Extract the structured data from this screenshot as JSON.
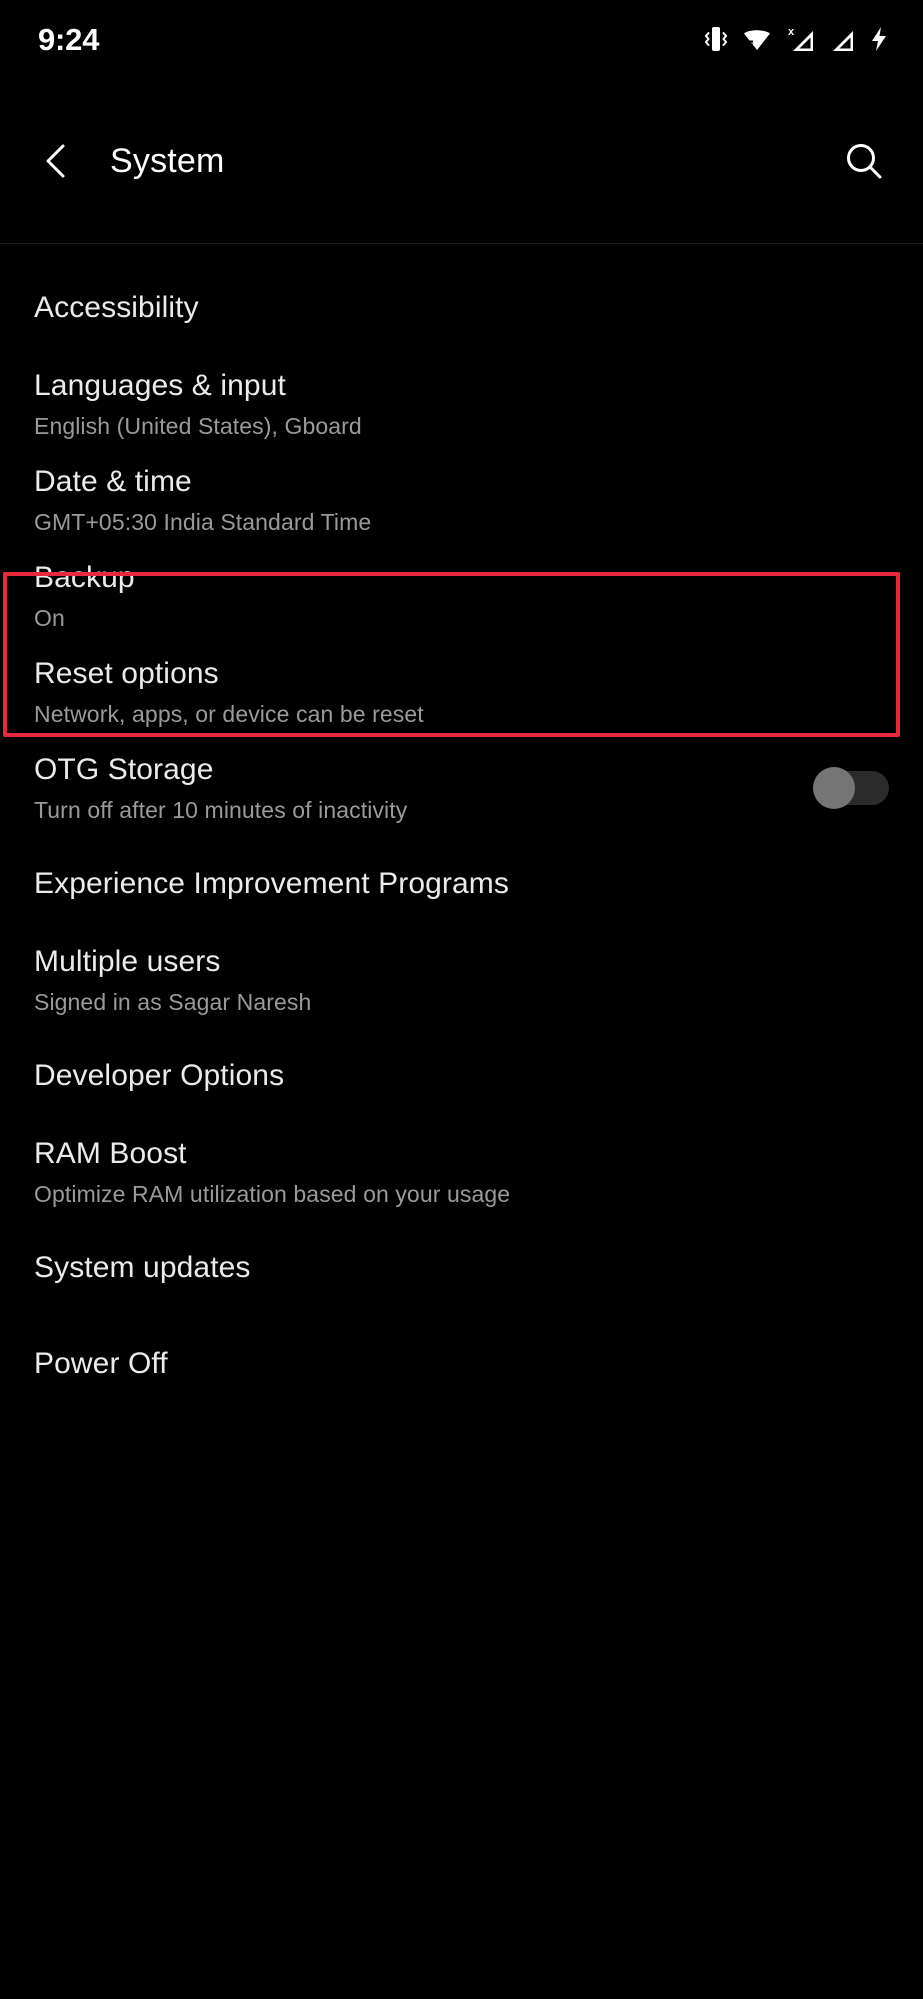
{
  "status_bar": {
    "time": "9:24",
    "icons": [
      {
        "name": "vibrate-icon",
        "label": "Vibrate"
      },
      {
        "name": "wifi-icon",
        "label": "Wi-Fi"
      },
      {
        "name": "signal-no-service-icon",
        "label": "No service"
      },
      {
        "name": "signal-bars-icon",
        "label": "Signal"
      },
      {
        "name": "charging-bolt-icon",
        "label": "Charging"
      }
    ]
  },
  "app_bar": {
    "back_icon": "chevron-left-icon",
    "title": "System",
    "search_icon": "search-icon"
  },
  "settings": {
    "items": [
      {
        "id": "accessibility",
        "title": "Accessibility",
        "subtitle": "",
        "control": "none"
      },
      {
        "id": "languages-input",
        "title": "Languages & input",
        "subtitle": "English (United States), Gboard",
        "control": "none"
      },
      {
        "id": "date-time",
        "title": "Date & time",
        "subtitle": "GMT+05:30 India Standard Time",
        "control": "none",
        "highlighted": true
      },
      {
        "id": "backup",
        "title": "Backup",
        "subtitle": "On",
        "control": "none"
      },
      {
        "id": "reset-options",
        "title": "Reset options",
        "subtitle": "Network, apps, or device can be reset",
        "control": "none"
      },
      {
        "id": "otg-storage",
        "title": "OTG Storage",
        "subtitle": "Turn off after 10 minutes of inactivity",
        "control": "toggle",
        "toggle_state": "off"
      },
      {
        "id": "experience-improvement-programs",
        "title": "Experience Improvement Programs",
        "subtitle": "",
        "control": "none"
      },
      {
        "id": "multiple-users",
        "title": "Multiple users",
        "subtitle": "Signed in as Sagar Naresh",
        "control": "none"
      },
      {
        "id": "developer-options",
        "title": "Developer Options",
        "subtitle": "",
        "control": "none"
      },
      {
        "id": "ram-boost",
        "title": "RAM Boost",
        "subtitle": "Optimize RAM utilization based on your usage",
        "control": "none"
      },
      {
        "id": "system-updates",
        "title": "System updates",
        "subtitle": "",
        "control": "none"
      },
      {
        "id": "power-off",
        "title": "Power Off",
        "subtitle": "",
        "control": "none"
      }
    ]
  },
  "annotation": {
    "target": "date-time",
    "color": "#e8283c"
  },
  "theme": {
    "background": "#000000",
    "title_color": "#ebebeb",
    "subtitle_color": "#9a9a9a",
    "accent_red": "#e8283c"
  }
}
